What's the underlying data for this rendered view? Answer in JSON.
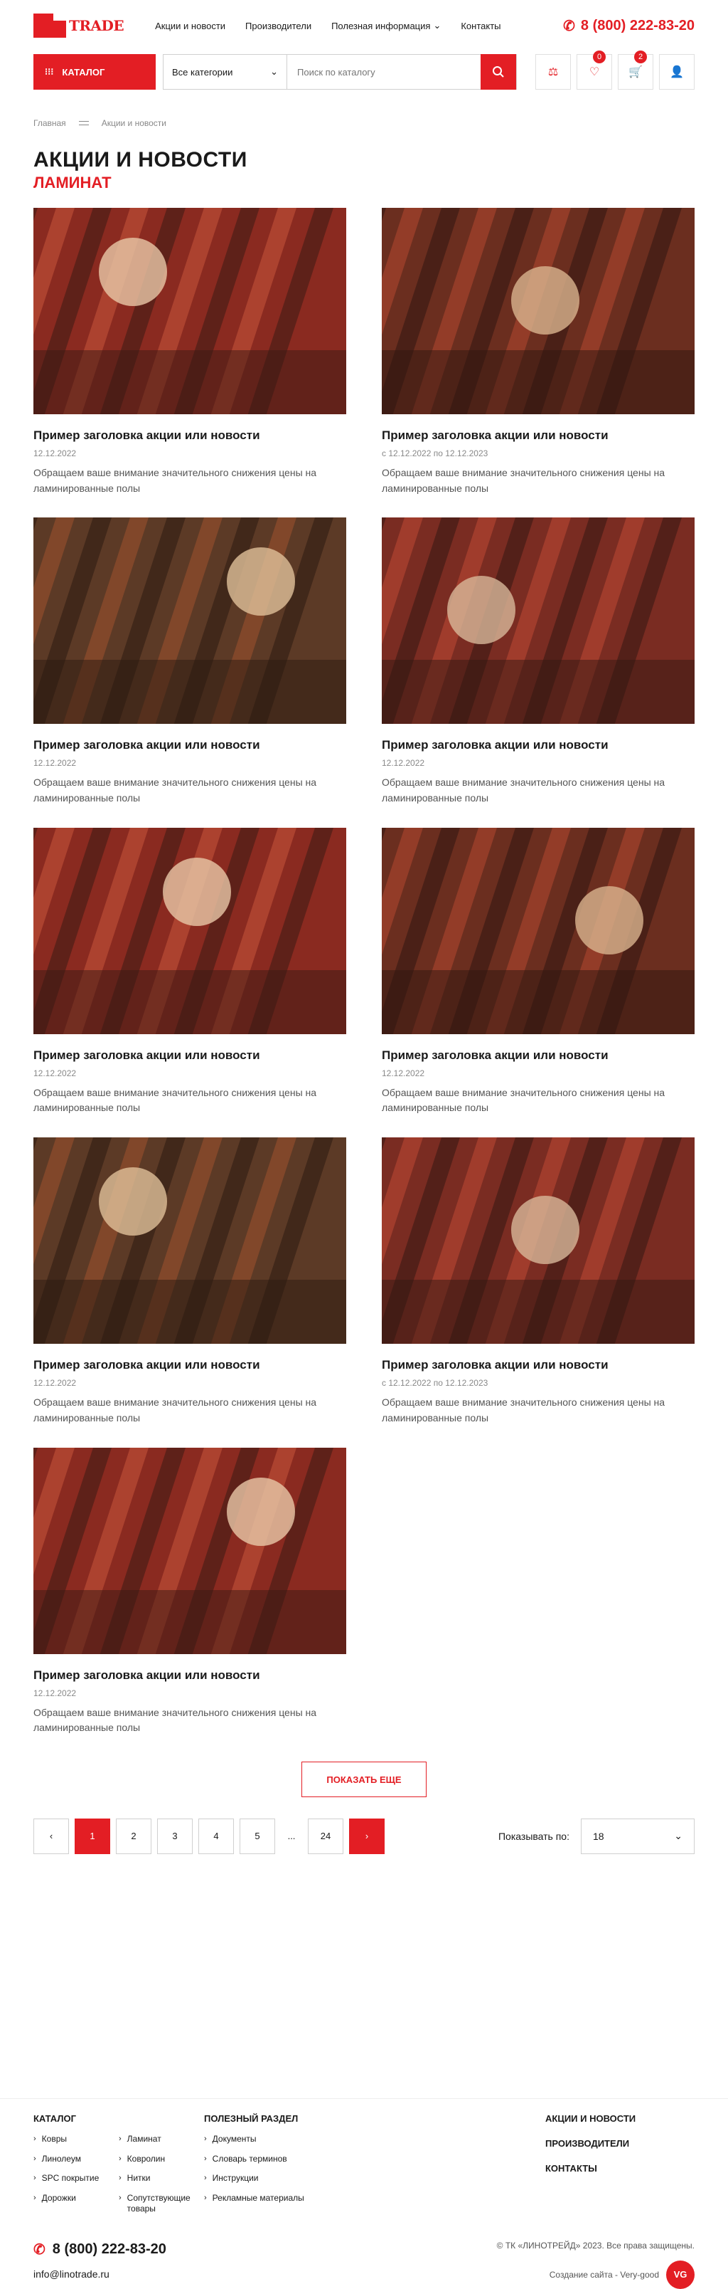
{
  "header": {
    "logo_text": "TRADE",
    "nav": [
      {
        "label": "Акции и новости"
      },
      {
        "label": "Производители"
      },
      {
        "label": "Полезная информация"
      },
      {
        "label": "Контакты"
      }
    ],
    "phone": "8 (800) 222-83-20",
    "catalog_label": "КАТАЛОГ",
    "search_category": "Все категории",
    "search_placeholder": "Поиск по каталогу",
    "cart_badges": [
      "0",
      "2"
    ]
  },
  "breadcrumbs": [
    "Главная",
    "Акции и новости"
  ],
  "page": {
    "title": "АКЦИИ И НОВОСТИ",
    "subtitle": "ЛАМИНАТ"
  },
  "colors": {
    "accent": "#e31e24",
    "text": "#1a1a1a",
    "muted": "#888888"
  },
  "cards": [
    {
      "title": "Пример заголовка акции или новости",
      "date": "12.12.2022",
      "desc": "Обращаем ваше внимание значительного снижения цены на ламинированные полы"
    },
    {
      "title": "Пример заголовка акции или новости",
      "date": "с 12.12.2022 по 12.12.2023",
      "desc": "Обращаем ваше внимание значительного снижения цены на ламинированные полы"
    },
    {
      "title": "Пример заголовка акции или новости",
      "date": "12.12.2022",
      "desc": "Обращаем ваше внимание значительного снижения цены на ламинированные полы"
    },
    {
      "title": "Пример заголовка акции или новости",
      "date": "12.12.2022",
      "desc": "Обращаем ваше внимание значительного снижения цены на ламинированные полы"
    },
    {
      "title": "Пример заголовка акции или новости",
      "date": "12.12.2022",
      "desc": "Обращаем ваше внимание значительного снижения цены на ламинированные полы"
    },
    {
      "title": "Пример заголовка акции или новости",
      "date": "12.12.2022",
      "desc": "Обращаем ваше внимание значительного снижения цены на ламинированные полы"
    },
    {
      "title": "Пример заголовка акции или новости",
      "date": "12.12.2022",
      "desc": "Обращаем ваше внимание значительного снижения цены на ламинированные полы"
    },
    {
      "title": "Пример заголовка акции или новости",
      "date": "с 12.12.2022 по 12.12.2023",
      "desc": "Обращаем ваше внимание значительного снижения цены на ламинированные полы"
    },
    {
      "title": "Пример заголовка акции или новости",
      "date": "12.12.2022",
      "desc": "Обращаем ваше внимание значительного снижения цены на ламинированные полы"
    }
  ],
  "pagination": {
    "show_more": "ПОКАЗАТЬ ЕЩЕ",
    "pages": [
      "1",
      "2",
      "3",
      "4",
      "5",
      "...",
      "24"
    ],
    "per_page_label": "Показывать по:",
    "per_page_value": "18"
  },
  "footer": {
    "catalog": {
      "title": "КАТАЛОГ",
      "items": [
        "Ковры",
        "Ламинат",
        "Линолеум",
        "Ковролин",
        "SPC покрытие",
        "Нитки",
        "Дорожки",
        "Сопутствующие товары"
      ]
    },
    "useful": {
      "title": "ПОЛЕЗНЫЙ РАЗДЕЛ",
      "items": [
        "Документы",
        "Словарь терминов",
        "Инструкции",
        "Рекламные материалы"
      ]
    },
    "links": [
      "АКЦИИ И НОВОСТИ",
      "ПРОИЗВОДИТЕЛИ",
      "КОНТАКТЫ"
    ],
    "phone": "8 (800) 222-83-20",
    "email": "info@linotrade.ru",
    "copyright": "© ТК «ЛИНОТРЕЙД» 2023. Все права защищены.",
    "developer": "Создание сайта - Very-good",
    "developer_logo": "VG"
  }
}
